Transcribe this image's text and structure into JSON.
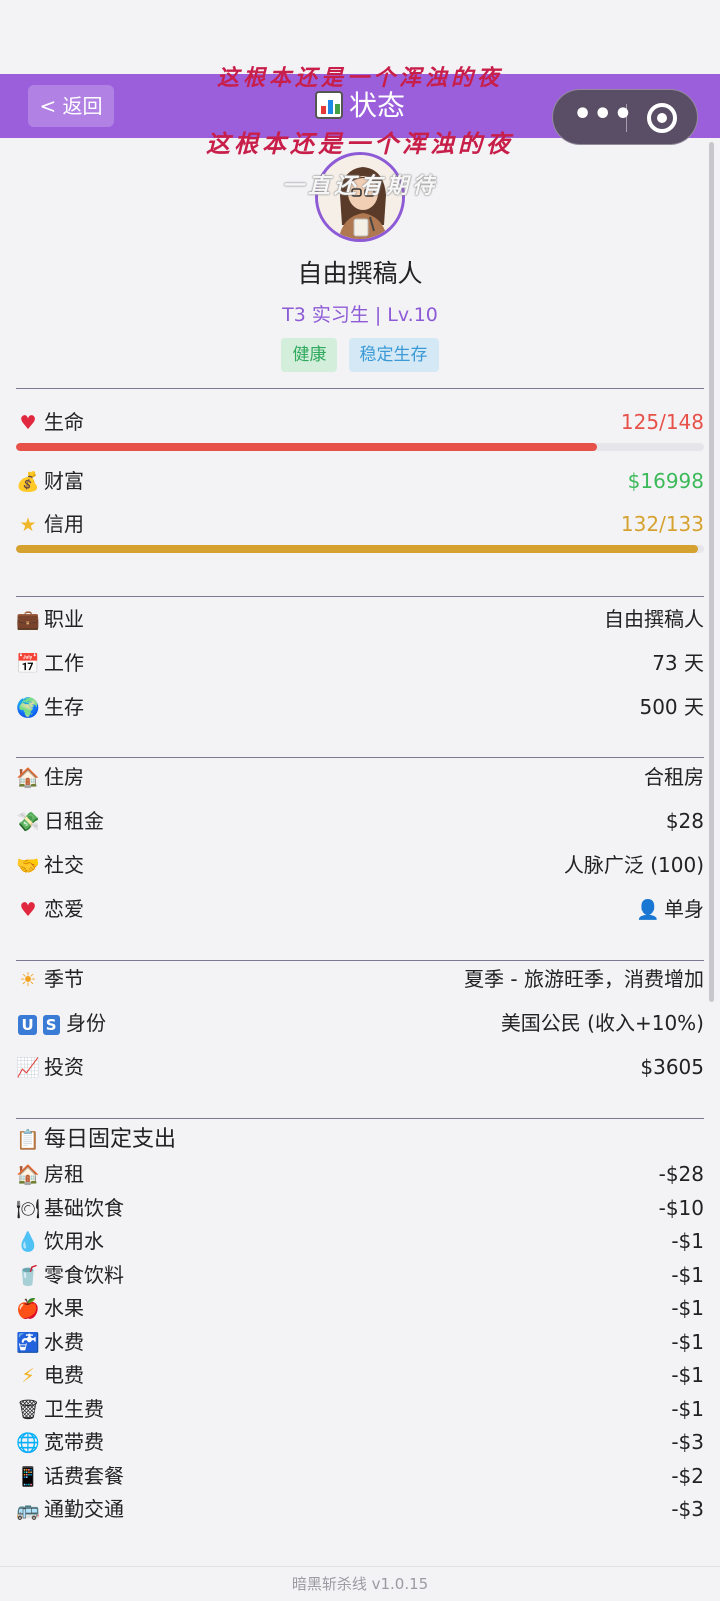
{
  "nav": {
    "back_label": "< 返回",
    "title": "状态",
    "title_icon": "bar-chart-icon",
    "capsule_menu_icon": "more-dots-icon",
    "capsule_close_icon": "target-icon"
  },
  "watermark": {
    "line1": "这根本还是一个浑浊的夜",
    "line2": "这根本还是一个浑浊的夜",
    "line3": "一直还有期待"
  },
  "profile": {
    "name": "自由撰稿人",
    "rank": "T3 实习生 | Lv.10",
    "tags": [
      "健康",
      "稳定生存"
    ]
  },
  "stats": {
    "life": {
      "icon": "heart-icon",
      "label": "生命",
      "value": "125/148",
      "fill": 0.845,
      "color": "#e8514a"
    },
    "wealth": {
      "icon": "money-bag-icon",
      "label": "财富",
      "value": "$16998",
      "color": "#3cba5a"
    },
    "credit": {
      "icon": "star-icon",
      "label": "信用",
      "value": "132/133",
      "fill": 0.992,
      "color": "#d6a22f"
    }
  },
  "career": [
    {
      "icon": "briefcase-icon",
      "label": "职业",
      "value": "自由撰稿人"
    },
    {
      "icon": "calendar-icon",
      "label": "工作",
      "value": "73 天"
    },
    {
      "icon": "globe-icon",
      "label": "生存",
      "value": "500 天"
    }
  ],
  "life_info": [
    {
      "icon": "house-icon",
      "label": "住房",
      "value": "合租房"
    },
    {
      "icon": "money-wings-icon",
      "label": "日租金",
      "value": "$28"
    },
    {
      "icon": "handshake-icon",
      "label": "社交",
      "value": "人脉广泛 (100)"
    },
    {
      "icon": "heart-icon",
      "label": "恋爱",
      "value": "单身",
      "value_icon": "person-icon"
    }
  ],
  "world": [
    {
      "icon": "sun-icon",
      "label": "季节",
      "value": "夏季 - 旅游旺季，消费增加"
    },
    {
      "icon": "us-flag-icon",
      "label": "身份",
      "value": "美国公民 (收入+10%)"
    },
    {
      "icon": "chart-up-icon",
      "label": "投资",
      "value": "$3605"
    }
  ],
  "expenses": {
    "title": "每日固定支出",
    "title_icon": "clipboard-icon",
    "items": [
      {
        "icon": "house-icon",
        "label": "房租",
        "value": "-$28"
      },
      {
        "icon": "fork-knife-icon",
        "label": "基础饮食",
        "value": "-$10"
      },
      {
        "icon": "droplet-icon",
        "label": "饮用水",
        "value": "-$1"
      },
      {
        "icon": "cup-icon",
        "label": "零食饮料",
        "value": "-$1"
      },
      {
        "icon": "apple-icon",
        "label": "水果",
        "value": "-$1"
      },
      {
        "icon": "water-tap-icon",
        "label": "水费",
        "value": "-$1"
      },
      {
        "icon": "lightning-icon",
        "label": "电费",
        "value": "-$1"
      },
      {
        "icon": "trash-icon",
        "label": "卫生费",
        "value": "-$1"
      },
      {
        "icon": "globe-grid-icon",
        "label": "宽带费",
        "value": "-$3"
      },
      {
        "icon": "phone-icon",
        "label": "话费套餐",
        "value": "-$2"
      },
      {
        "icon": "bus-icon",
        "label": "通勤交通",
        "value": "-$3"
      }
    ]
  },
  "footer": {
    "text": "暗黑斩杀线 v1.0.15"
  }
}
